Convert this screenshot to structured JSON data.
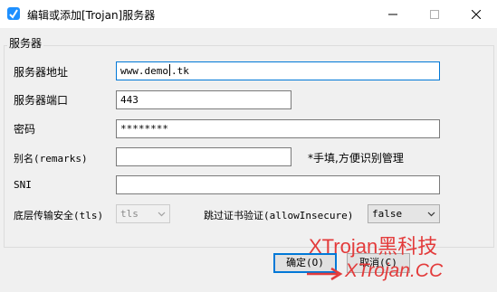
{
  "window": {
    "title": "编辑或添加[Trojan]服务器",
    "icons": {
      "app": "app-icon",
      "minimize": "minimize-icon",
      "maximize": "maximize-icon",
      "close": "close-icon"
    }
  },
  "group": {
    "title": "服务器"
  },
  "form": {
    "address": {
      "label": "服务器地址",
      "value_before_caret": "www.demo",
      "value_after_caret": ".tk"
    },
    "port": {
      "label": "服务器端口",
      "value": "443"
    },
    "password": {
      "label": "密码",
      "value": "********"
    },
    "remarks": {
      "label": "别名(remarks)",
      "value": "",
      "hint": "*手填,方便识别管理"
    },
    "sni": {
      "label": "SNI",
      "value": ""
    },
    "tls": {
      "label": "底层传输安全(tls)",
      "selected": "tls"
    },
    "allow_insecure": {
      "label": "跳过证书验证(allowInsecure)",
      "selected": "false"
    }
  },
  "buttons": {
    "ok": "确定(O)",
    "cancel": "取消(C)"
  },
  "watermark": {
    "line1": "XTrojan黑科技",
    "line2": "XTrojan.CC",
    "color": "#e33b3b"
  },
  "colors": {
    "accent": "#0078d7"
  }
}
